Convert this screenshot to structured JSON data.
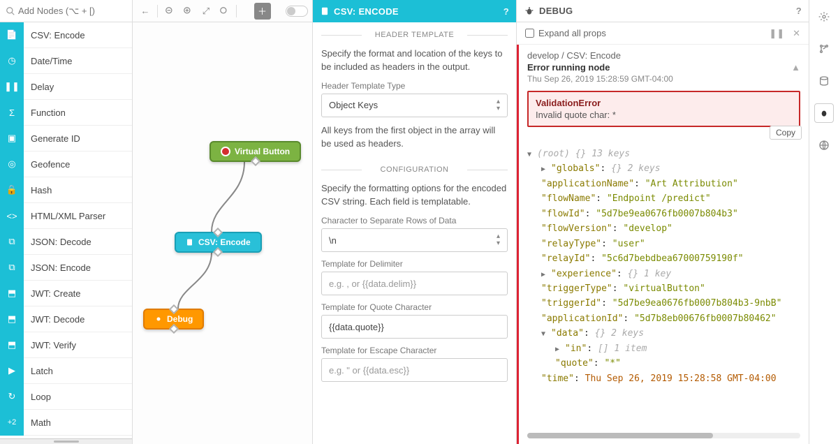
{
  "search": {
    "placeholder": "Add Nodes (⌥ + [)"
  },
  "nodes": [
    {
      "label": "CSV: Encode",
      "icon": "file"
    },
    {
      "label": "Date/Time",
      "icon": "clock"
    },
    {
      "label": "Delay",
      "icon": "pause"
    },
    {
      "label": "Function",
      "icon": "sigma"
    },
    {
      "label": "Generate ID",
      "icon": "badge"
    },
    {
      "label": "Geofence",
      "icon": "target"
    },
    {
      "label": "Hash",
      "icon": "lock"
    },
    {
      "label": "HTML/XML Parser",
      "icon": "code"
    },
    {
      "label": "JSON: Decode",
      "icon": "json"
    },
    {
      "label": "JSON: Encode",
      "icon": "json"
    },
    {
      "label": "JWT: Create",
      "icon": "jwt"
    },
    {
      "label": "JWT: Decode",
      "icon": "jwt"
    },
    {
      "label": "JWT: Verify",
      "icon": "jwt"
    },
    {
      "label": "Latch",
      "icon": "run"
    },
    {
      "label": "Loop",
      "icon": "loop"
    },
    {
      "label": "Math",
      "icon": "plus2"
    }
  ],
  "canvas": {
    "virtual_button": "Virtual Button",
    "csv_encode": "CSV: Encode",
    "debug": "Debug"
  },
  "props": {
    "title": "CSV: ENCODE",
    "header_section": "HEADER TEMPLATE",
    "header_desc": "Specify the format and location of the keys to be included as headers in the output.",
    "header_type_label": "Header Template Type",
    "header_type_value": "Object Keys",
    "header_note": "All keys from the first object in the array will be used as headers.",
    "config_section": "CONFIGURATION",
    "config_desc": "Specify the formatting options for the encoded CSV string. Each field is templatable.",
    "row_sep_label": "Character to Separate Rows of Data",
    "row_sep_value": "\\n",
    "delim_label": "Template for Delimiter",
    "delim_placeholder": "e.g. , or {{data.delim}}",
    "quote_label": "Template for Quote Character",
    "quote_value": "{{data.quote}}",
    "esc_label": "Template for Escape Character",
    "esc_placeholder": "e.g. \" or {{data.esc}}"
  },
  "debug": {
    "title": "DEBUG",
    "expand": "Expand all props",
    "crumb": "develop / CSV: Encode",
    "heading": "Error running node",
    "timestamp": "Thu Sep 26, 2019 15:28:59 GMT-04:00",
    "err_type": "ValidationError",
    "err_msg": "Invalid quote char: *",
    "copy": "Copy",
    "root_meta": "(root)  {}  13 keys",
    "tree": {
      "globals_meta": "{}  2 keys",
      "applicationName": "Art Attribution",
      "flowName": "Endpoint /predict",
      "flowId": "5d7be9ea0676fb0007b804b3",
      "flowVersion": "develop",
      "relayType": "user",
      "relayId": "5c6d7bebdbea67000759190f",
      "experience_meta": "{}  1 key",
      "triggerType": "virtualButton",
      "triggerId": "5d7be9ea0676fb0007b804b3-9nbB",
      "applicationId": "5d7b8eb00676fb0007b80462",
      "data_meta": "{}  2 keys",
      "in_meta": "[]  1 item",
      "quote": "*",
      "time": "Thu Sep 26, 2019 15:28:58 GMT-04:00"
    }
  }
}
